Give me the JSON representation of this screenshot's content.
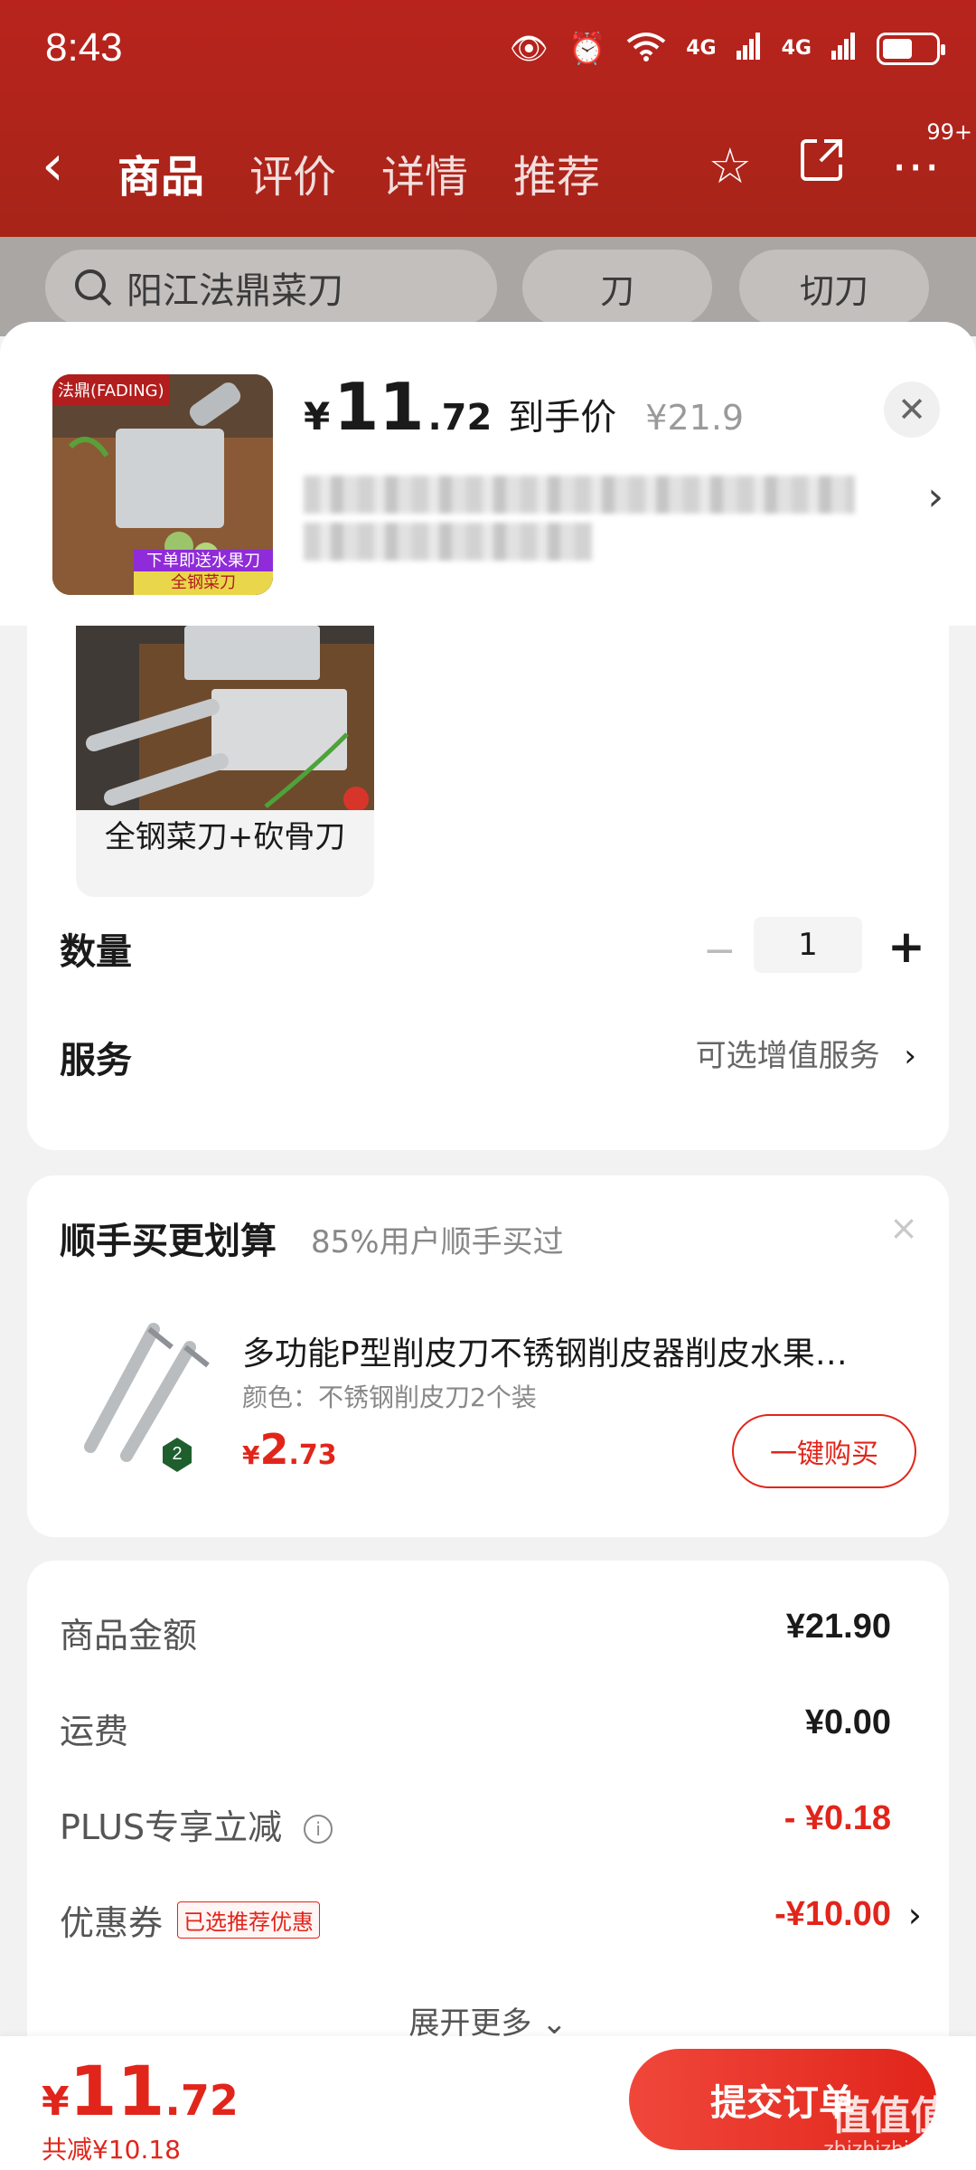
{
  "status_bar": {
    "time": "8:43",
    "net1": "4G",
    "net2": "4G"
  },
  "nav": {
    "back_icon": "‹",
    "tabs": [
      "商品",
      "评价",
      "详情",
      "推荐"
    ],
    "badge": "99+"
  },
  "search": {
    "text": "阳江法鼎菜刀",
    "chips": [
      "刀",
      "切刀"
    ]
  },
  "product": {
    "thumb_brand": "法鼎(FADING)",
    "thumb_promo_1": "下单即送水果刀",
    "thumb_promo_2": "全钢菜刀",
    "price_symbol": "¥",
    "price_int": "11",
    "price_dec": ".72",
    "price_tag": "到手价",
    "original_price": "¥21.9"
  },
  "spec": {
    "option_label": "全钢菜刀+砍骨刀"
  },
  "quantity": {
    "label": "数量",
    "minus": "−",
    "value": "1",
    "plus": "+"
  },
  "service": {
    "label": "服务",
    "link": "可选增值服务",
    "chevron": "›"
  },
  "addon": {
    "title": "顺手买更划算",
    "subtitle": "85%用户顺手买过",
    "close": "×",
    "name": "多功能P型削皮刀不锈钢削皮器削皮水果…",
    "spec": "颜色：不锈钢削皮刀2个装",
    "qty_badge": "2",
    "price_symbol": "¥",
    "price_int": "2",
    "price_dec": ".73",
    "buy_label": "一键购买"
  },
  "summary": {
    "goods_label": "商品金额",
    "goods_value": "¥21.90",
    "shipping_label": "运费",
    "shipping_value": "¥0.00",
    "plus_label": "PLUS专享立减",
    "plus_value": "- ¥0.18",
    "coupon_label": "优惠券",
    "coupon_tag": "已选推荐优惠",
    "coupon_value": "-¥10.00",
    "expand_label": "展开更多 ⌄"
  },
  "bottom": {
    "price_symbol": "¥",
    "price_int": "11",
    "price_dec": ".72",
    "saved": "共减¥10.18",
    "submit_label": "提交订单",
    "watermark_glyph": "值值值",
    "watermark_text": "zhizhizhi.com"
  },
  "colors": {
    "accent": "#e1251b",
    "header": "#b8241d"
  }
}
